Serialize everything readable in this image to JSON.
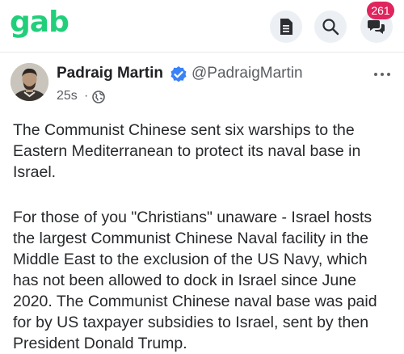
{
  "app": {
    "logo_text": "gab",
    "brand_color": "#21cf7a",
    "toolbar": {
      "notes_icon": "document-icon",
      "search_icon": "search-icon",
      "chat_icon": "chat-bubbles-icon",
      "chat_badge_count": "261",
      "badge_color": "#e0245e"
    }
  },
  "post": {
    "author": {
      "name": "Padraig Martin",
      "handle": "@PadraigMartin",
      "verified": true,
      "verified_color": "#3a82f7"
    },
    "timestamp": "25s",
    "separator": "·",
    "visibility_icon": "globe-icon",
    "more_icon": "more-horizontal-icon",
    "paragraphs": [
      "The Communist Chinese sent six warships to the\nEastern Mediterranean to protect its naval base in\nIsrael.",
      "For those of you \"Christians\" unaware - Israel hosts\nthe largest Communist Chinese Naval facility in the\nMiddle East to the exclusion of the US Navy, which\nhas not been allowed to dock in Israel since June\n2020. The Communist Chinese naval base was paid\nfor by US taxpayer subsidies to Israel, sent by then\nPresident Donald Trump."
    ]
  }
}
